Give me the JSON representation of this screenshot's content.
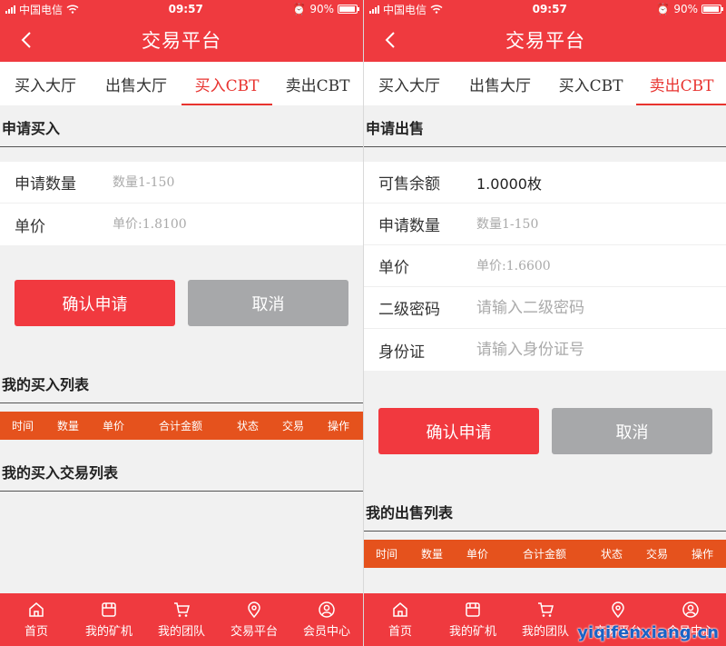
{
  "status_bar": {
    "carrier": "中国电信",
    "time": "09:57",
    "battery": "90%"
  },
  "nav": {
    "title": "交易平台"
  },
  "tabs": [
    "买入大厅",
    "出售大厅",
    "买入CBT",
    "卖出CBT"
  ],
  "left": {
    "active_tab": 2,
    "section_title": "申请买入",
    "fields": [
      {
        "label": "申请数量",
        "placeholder": "数量1-150"
      },
      {
        "label": "单价",
        "placeholder": "单价:1.8100"
      }
    ],
    "confirm_label": "确认申请",
    "cancel_label": "取消",
    "list_title": "我的买入列表",
    "columns": [
      "时间",
      "数量",
      "单价",
      "合计金额",
      "状态",
      "交易",
      "操作"
    ],
    "trade_list_title": "我的买入交易列表"
  },
  "right": {
    "active_tab": 3,
    "section_title": "申请出售",
    "balance_label": "可售余额",
    "balance_value": "1.0000枚",
    "fields": [
      {
        "label": "申请数量",
        "placeholder": "数量1-150"
      },
      {
        "label": "单价",
        "placeholder": "单价:1.6600"
      },
      {
        "label": "二级密码",
        "placeholder": "请输入二级密码"
      },
      {
        "label": "身份证",
        "placeholder": "请输入身份证号"
      }
    ],
    "confirm_label": "确认申请",
    "cancel_label": "取消",
    "list_title": "我的出售列表",
    "columns": [
      "时间",
      "数量",
      "单价",
      "合计金额",
      "状态",
      "交易",
      "操作"
    ]
  },
  "tabbar": [
    "首页",
    "我的矿机",
    "我的团队",
    "交易平台",
    "会员中心"
  ],
  "icons": [
    "home-icon",
    "shop-icon",
    "cart-icon",
    "location-icon",
    "user-icon"
  ],
  "watermark": "yiqifenxiang.cn",
  "colors": {
    "primary": "#ef3a3f",
    "table_header": "#e5521d",
    "cancel": "#a7a8aa"
  }
}
